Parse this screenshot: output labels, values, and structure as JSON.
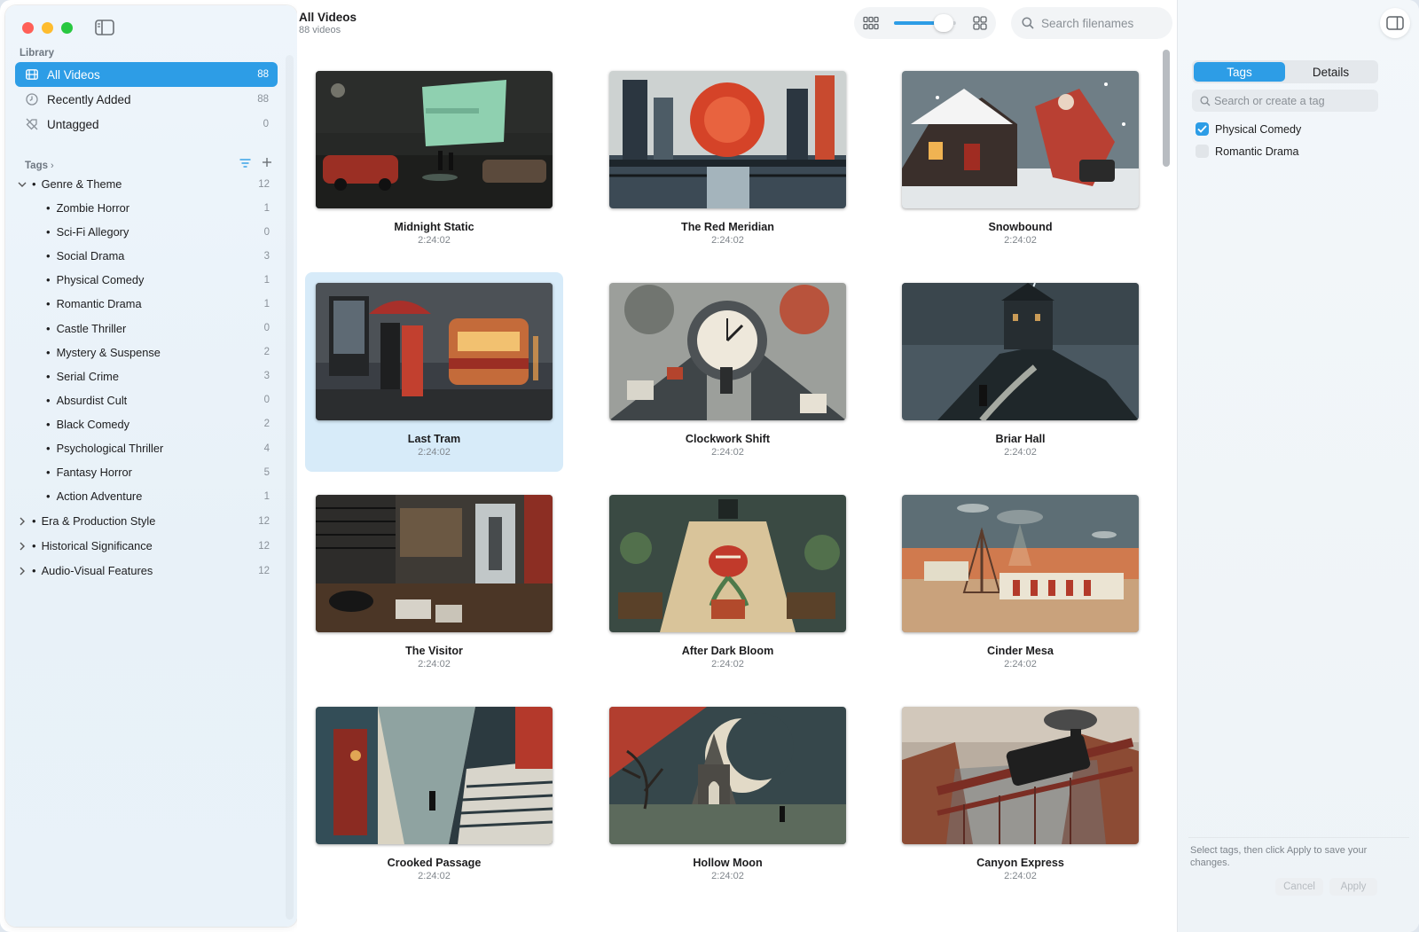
{
  "library": {
    "section_label": "Library",
    "items": [
      {
        "label": "All Videos",
        "count": "88",
        "icon": "film-icon"
      },
      {
        "label": "Recently Added",
        "count": "88",
        "icon": "clock-icon"
      },
      {
        "label": "Untagged",
        "count": "0",
        "icon": "tag-slash-icon"
      }
    ]
  },
  "tags": {
    "section_label": "Tags",
    "groups": [
      {
        "label": "Genre & Theme",
        "count": "12",
        "expanded": true,
        "children": [
          {
            "label": "Zombie Horror",
            "count": "1"
          },
          {
            "label": "Sci-Fi Allegory",
            "count": "0"
          },
          {
            "label": "Social Drama",
            "count": "3"
          },
          {
            "label": "Physical Comedy",
            "count": "1"
          },
          {
            "label": "Romantic Drama",
            "count": "1"
          },
          {
            "label": "Castle Thriller",
            "count": "0"
          },
          {
            "label": "Mystery & Suspense",
            "count": "2"
          },
          {
            "label": "Serial Crime",
            "count": "3"
          },
          {
            "label": "Absurdist Cult",
            "count": "0"
          },
          {
            "label": "Black Comedy",
            "count": "2"
          },
          {
            "label": "Psychological Thriller",
            "count": "4"
          },
          {
            "label": "Fantasy Horror",
            "count": "5"
          },
          {
            "label": "Action Adventure",
            "count": "1"
          }
        ]
      },
      {
        "label": "Era & Production Style",
        "count": "12",
        "expanded": false
      },
      {
        "label": "Historical Significance",
        "count": "12",
        "expanded": false
      },
      {
        "label": "Audio-Visual Features",
        "count": "12",
        "expanded": false
      }
    ]
  },
  "header": {
    "title": "All Videos",
    "subtitle": "88 videos",
    "zoom_level": 0.8,
    "search_placeholder": "Search filenames"
  },
  "videos": [
    {
      "title": "Midnight Static",
      "duration": "2:24:02",
      "selected": false
    },
    {
      "title": "The Red Meridian",
      "duration": "2:24:02",
      "selected": false
    },
    {
      "title": "Snowbound",
      "duration": "2:24:02",
      "selected": false
    },
    {
      "title": "Last Tram",
      "duration": "2:24:02",
      "selected": true
    },
    {
      "title": "Clockwork Shift",
      "duration": "2:24:02",
      "selected": false
    },
    {
      "title": "Briar Hall",
      "duration": "2:24:02",
      "selected": false
    },
    {
      "title": "The Visitor",
      "duration": "2:24:02",
      "selected": false
    },
    {
      "title": "After Dark Bloom",
      "duration": "2:24:02",
      "selected": false
    },
    {
      "title": "Cinder Mesa",
      "duration": "2:24:02",
      "selected": false
    },
    {
      "title": "Crooked Passage",
      "duration": "2:24:02",
      "selected": false
    },
    {
      "title": "Hollow Moon",
      "duration": "2:24:02",
      "selected": false
    },
    {
      "title": "Canyon Express",
      "duration": "2:24:02",
      "selected": false
    }
  ],
  "panel": {
    "tabs": [
      "Tags",
      "Details"
    ],
    "active_tab": "Tags",
    "tag_search_placeholder": "Search or create a tag",
    "tag_options": [
      {
        "label": "Physical Comedy",
        "checked": true
      },
      {
        "label": "Romantic Drama",
        "checked": false
      }
    ],
    "hint": "Select tags, then click Apply to save your changes.",
    "cancel_label": "Cancel",
    "apply_label": "Apply"
  },
  "colors": {
    "accent": "#2d9de6",
    "selected_card": "#d7ebf9"
  }
}
